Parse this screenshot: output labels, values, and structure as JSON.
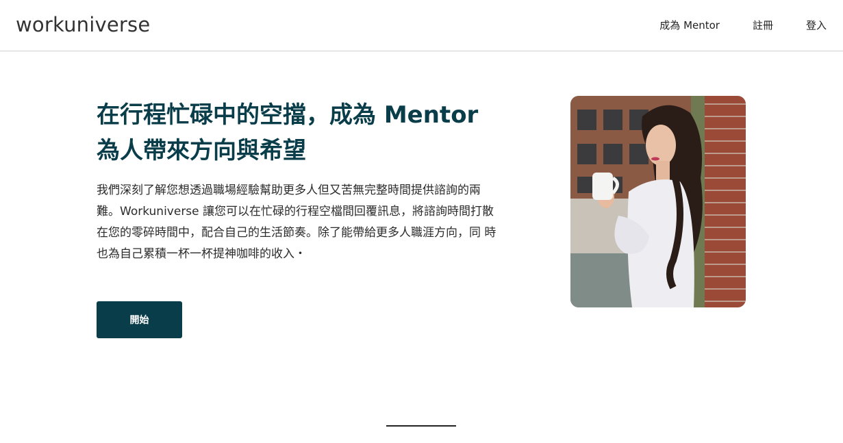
{
  "header": {
    "logo_text": "workuniverse",
    "nav": [
      {
        "label": "成為 Mentor"
      },
      {
        "label": "註冊"
      },
      {
        "label": "登入"
      }
    ]
  },
  "hero": {
    "title_line1": "在行程忙碌中的空擋，成為 Mentor",
    "title_line2": "為人帶來方向與希望",
    "description": "我們深刻了解您想透過職場經驗幫助更多人但又苦無完整時間提供諮詢的兩難。Workuniverse 讓您可以在忙碌的行程空檔間回覆訊息，將諮詢時間打散在您的零碎時間中，配合自己的生活節奏。除了能帶給更多人職涯方向，同 時也為自己累積一杯一杯提神咖啡的收入・",
    "cta_label": "開始"
  },
  "colors": {
    "primary": "#0a3d4a",
    "text": "#222222",
    "divider": "#222222"
  }
}
